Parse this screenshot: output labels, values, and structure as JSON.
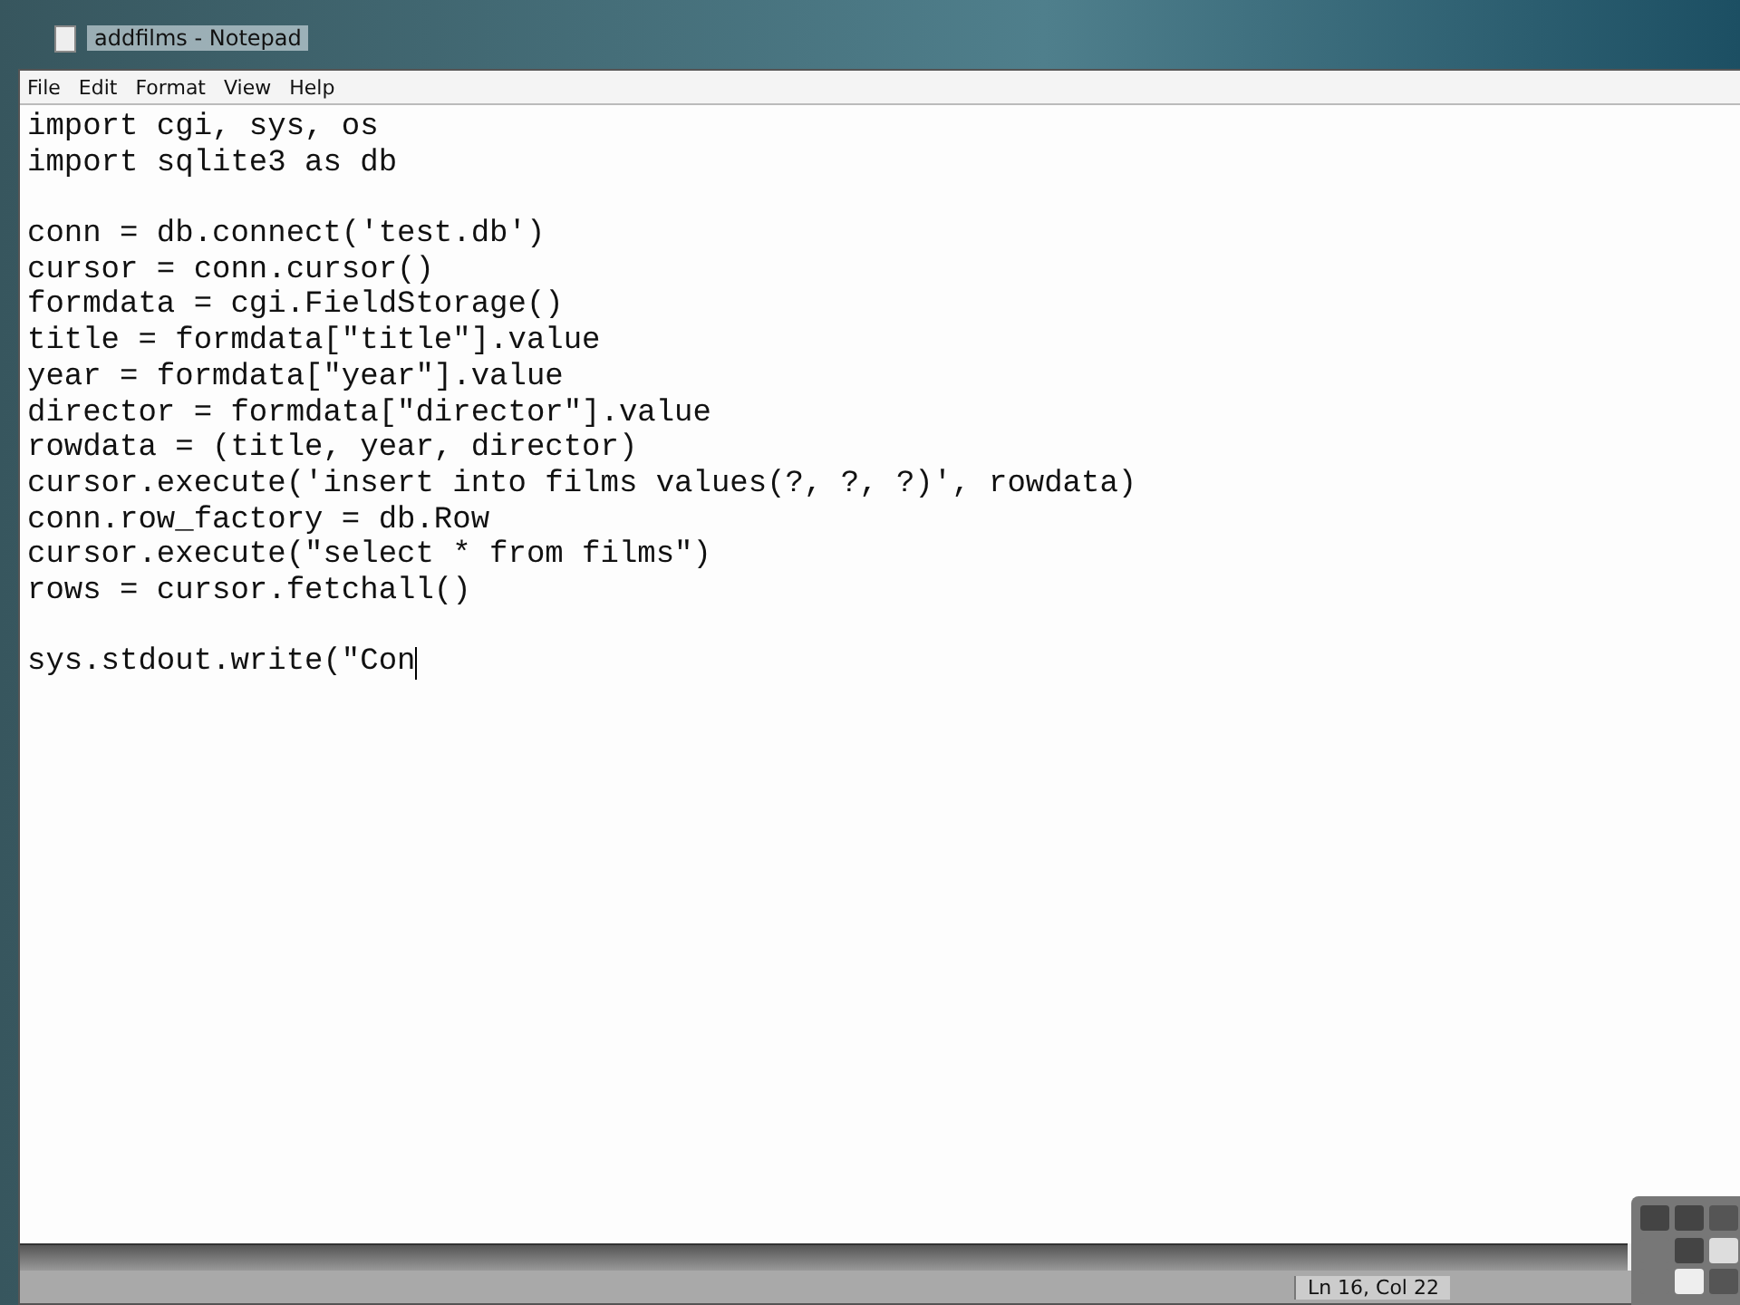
{
  "window": {
    "title": "addfilms - Notepad"
  },
  "menu": [
    "File",
    "Edit",
    "Format",
    "View",
    "Help"
  ],
  "editor": {
    "blocks": [
      [
        "import cgi, sys, os",
        "import sqlite3 as db"
      ],
      [
        "conn = db.connect('test.db')",
        "cursor = conn.cursor()",
        "formdata = cgi.FieldStorage()",
        "title = formdata[\"title\"].value",
        "year = formdata[\"year\"].value",
        "director = formdata[\"director\"].value",
        "rowdata = (title, year, director)",
        "cursor.execute('insert into films values(?, ?, ?)', rowdata)",
        "conn.row_factory = db.Row",
        "cursor.execute(\"select * from films\")",
        "rows = cursor.fetchall()"
      ],
      [
        "sys.stdout.write(\"Con"
      ]
    ]
  },
  "status_bar": {
    "position": "Ln 16, Col 22"
  }
}
